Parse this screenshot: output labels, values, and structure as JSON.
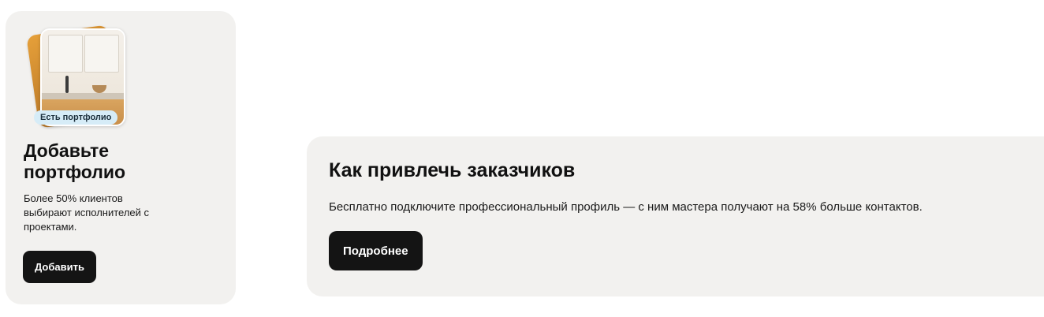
{
  "portfolio_card": {
    "badge": "Есть портфолио",
    "title": "Добавьте портфолио",
    "description": "Более 50% клиентов выбирают исполнителей с проектами.",
    "button_label": "Добавить"
  },
  "customers_card": {
    "title": "Как привлечь заказчиков",
    "description": "Бесплатно подключите профессиональный профиль — с ним мастера получают на 58% больше контактов.",
    "button_label": "Подробнее"
  },
  "colors": {
    "card_background": "#f2f1ef",
    "button_background": "#141414",
    "button_text": "#ffffff",
    "badge_background": "#d6ecf7"
  }
}
